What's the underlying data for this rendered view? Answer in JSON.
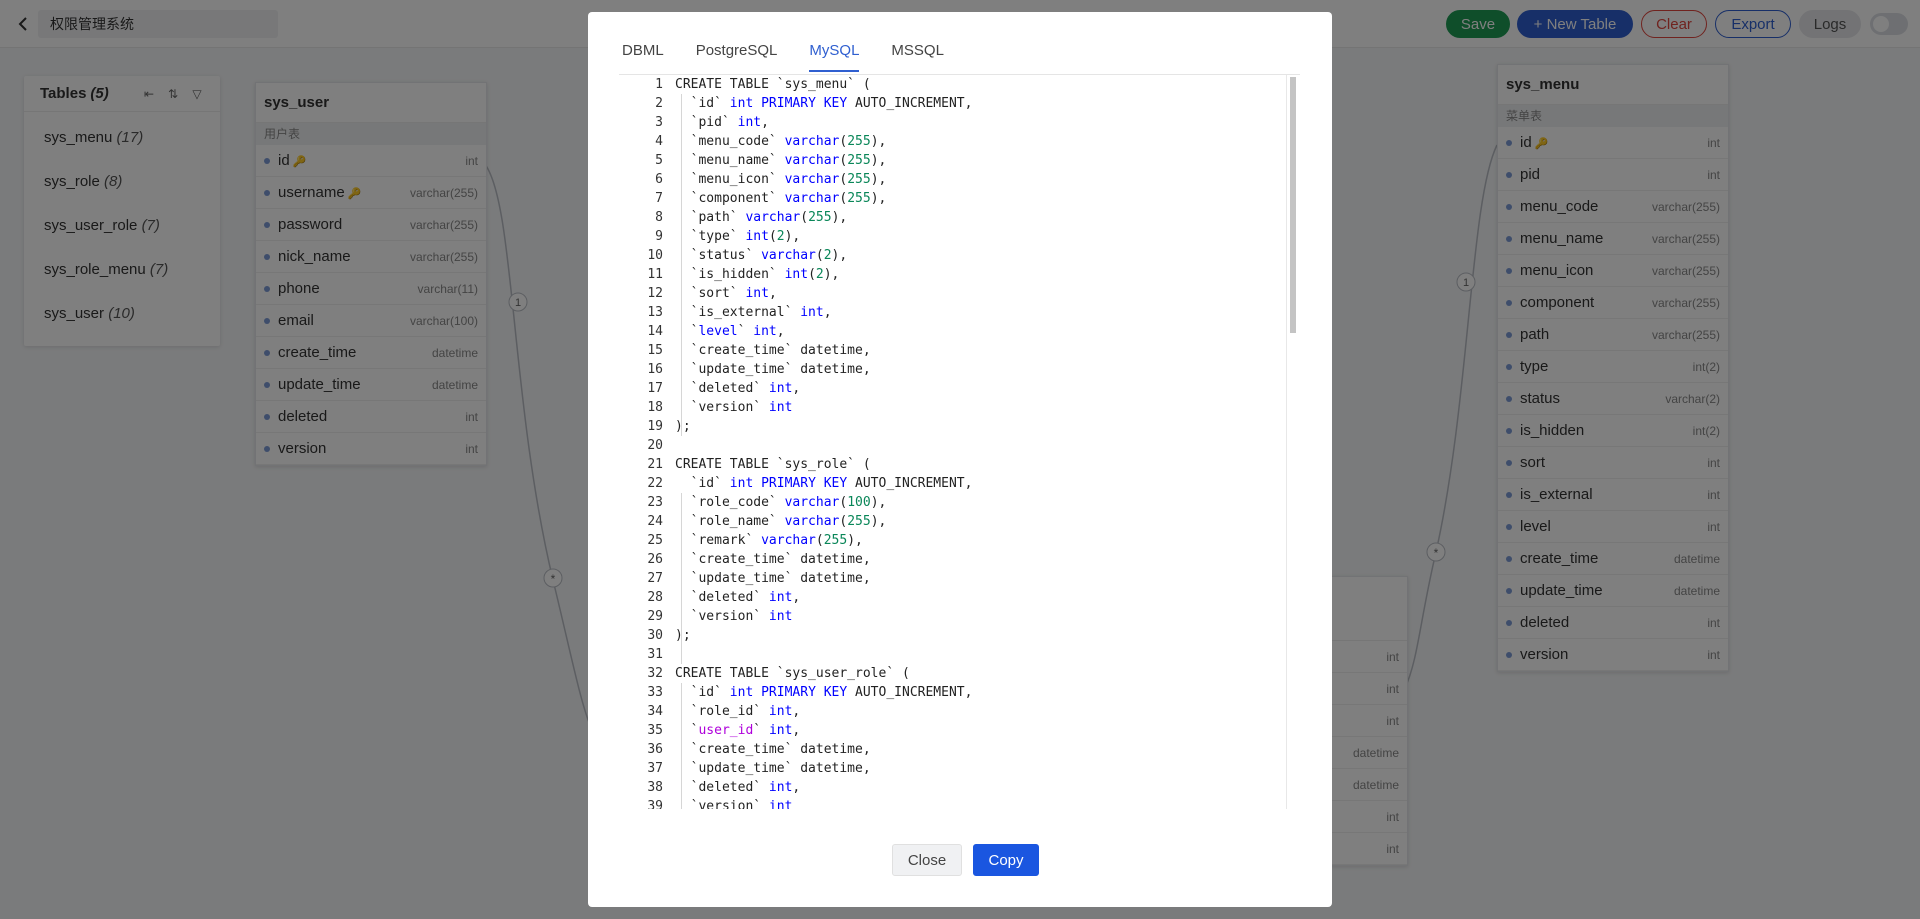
{
  "header": {
    "project_name": "权限管理系统",
    "save_label": "Save",
    "new_table_label": "+ New Table",
    "clear_label": "Clear",
    "export_label": "Export",
    "logs_label": "Logs"
  },
  "colors": {
    "save": "#1f9d55",
    "primary": "#2f5fd0",
    "danger": "#e0463e",
    "copy": "#1a56e0"
  },
  "sidebar": {
    "title": "Tables",
    "count": "(5)",
    "icons": [
      "collapse-left-icon",
      "sort-icon",
      "filter-icon"
    ],
    "items": [
      {
        "name": "sys_menu",
        "count": "(17)"
      },
      {
        "name": "sys_role",
        "count": "(8)"
      },
      {
        "name": "sys_user_role",
        "count": "(7)"
      },
      {
        "name": "sys_role_menu",
        "count": "(7)"
      },
      {
        "name": "sys_user",
        "count": "(10)"
      }
    ]
  },
  "sys_user": {
    "title": "sys_user",
    "note": "用户表",
    "fields": [
      {
        "name": "id",
        "type": "int",
        "key": "primary"
      },
      {
        "name": "username",
        "type": "varchar(255)",
        "key": "secondary"
      },
      {
        "name": "password",
        "type": "varchar(255)"
      },
      {
        "name": "nick_name",
        "type": "varchar(255)"
      },
      {
        "name": "phone",
        "type": "varchar(11)"
      },
      {
        "name": "email",
        "type": "varchar(100)"
      },
      {
        "name": "create_time",
        "type": "datetime"
      },
      {
        "name": "update_time",
        "type": "datetime"
      },
      {
        "name": "deleted",
        "type": "int"
      },
      {
        "name": "version",
        "type": "int"
      }
    ]
  },
  "sys_menu": {
    "title": "sys_menu",
    "note": "菜单表",
    "fields": [
      {
        "name": "id",
        "type": "int",
        "key": "primary"
      },
      {
        "name": "pid",
        "type": "int"
      },
      {
        "name": "menu_code",
        "type": "varchar(255)"
      },
      {
        "name": "menu_name",
        "type": "varchar(255)"
      },
      {
        "name": "menu_icon",
        "type": "varchar(255)"
      },
      {
        "name": "component",
        "type": "varchar(255)"
      },
      {
        "name": "path",
        "type": "varchar(255)"
      },
      {
        "name": "type",
        "type": "int(2)"
      },
      {
        "name": "status",
        "type": "varchar(2)"
      },
      {
        "name": "is_hidden",
        "type": "int(2)"
      },
      {
        "name": "sort",
        "type": "int"
      },
      {
        "name": "is_external",
        "type": "int"
      },
      {
        "name": "level",
        "type": "int"
      },
      {
        "name": "create_time",
        "type": "datetime"
      },
      {
        "name": "update_time",
        "type": "datetime"
      },
      {
        "name": "deleted",
        "type": "int"
      },
      {
        "name": "version",
        "type": "int"
      }
    ]
  },
  "middle_table": {
    "types": [
      "int",
      "int",
      "int",
      "datetime",
      "datetime",
      "int",
      "int"
    ]
  },
  "relations": {
    "one_left": "1",
    "many_left": "*",
    "one_right": "1",
    "many_right": "*"
  },
  "modal": {
    "tabs": [
      "DBML",
      "PostgreSQL",
      "MySQL",
      "MSSQL"
    ],
    "active_tab": "MySQL",
    "close_label": "Close",
    "copy_label": "Copy",
    "code_lines": [
      [
        [
          "CREATE TABLE `sys_menu` (",
          ""
        ]
      ],
      [
        [
          "  `id` ",
          ""
        ],
        [
          "int PRIMARY KEY",
          "kw"
        ],
        [
          " AUTO_INCREMENT,",
          ""
        ]
      ],
      [
        [
          "  `pid` ",
          ""
        ],
        [
          "int",
          "kw"
        ],
        [
          ",",
          ""
        ]
      ],
      [
        [
          "  `menu_code` ",
          ""
        ],
        [
          "varchar",
          "kw"
        ],
        [
          "(",
          ""
        ],
        [
          "255",
          "num"
        ],
        [
          "),",
          ""
        ]
      ],
      [
        [
          "  `menu_name` ",
          ""
        ],
        [
          "varchar",
          "kw"
        ],
        [
          "(",
          ""
        ],
        [
          "255",
          "num"
        ],
        [
          "),",
          ""
        ]
      ],
      [
        [
          "  `menu_icon` ",
          ""
        ],
        [
          "varchar",
          "kw"
        ],
        [
          "(",
          ""
        ],
        [
          "255",
          "num"
        ],
        [
          "),",
          ""
        ]
      ],
      [
        [
          "  `component` ",
          ""
        ],
        [
          "varchar",
          "kw"
        ],
        [
          "(",
          ""
        ],
        [
          "255",
          "num"
        ],
        [
          "),",
          ""
        ]
      ],
      [
        [
          "  `path` ",
          ""
        ],
        [
          "varchar",
          "kw"
        ],
        [
          "(",
          ""
        ],
        [
          "255",
          "num"
        ],
        [
          "),",
          ""
        ]
      ],
      [
        [
          "  `type` ",
          ""
        ],
        [
          "int",
          "kw"
        ],
        [
          "(",
          ""
        ],
        [
          "2",
          "num"
        ],
        [
          "),",
          ""
        ]
      ],
      [
        [
          "  `status` ",
          ""
        ],
        [
          "varchar",
          "kw"
        ],
        [
          "(",
          ""
        ],
        [
          "2",
          "num"
        ],
        [
          "),",
          ""
        ]
      ],
      [
        [
          "  `is_hidden` ",
          ""
        ],
        [
          "int",
          "kw"
        ],
        [
          "(",
          ""
        ],
        [
          "2",
          "num"
        ],
        [
          "),",
          ""
        ]
      ],
      [
        [
          "  `sort` ",
          ""
        ],
        [
          "int",
          "kw"
        ],
        [
          ",",
          ""
        ]
      ],
      [
        [
          "  `is_external` ",
          ""
        ],
        [
          "int",
          "kw"
        ],
        [
          ",",
          ""
        ]
      ],
      [
        [
          "  `",
          ""
        ],
        [
          "level",
          "kw"
        ],
        [
          "` ",
          ""
        ],
        [
          "int",
          "kw"
        ],
        [
          ",",
          ""
        ]
      ],
      [
        [
          "  `create_time` datetime,",
          ""
        ]
      ],
      [
        [
          "  `update_time` datetime,",
          ""
        ]
      ],
      [
        [
          "  `deleted` ",
          ""
        ],
        [
          "int",
          "kw"
        ],
        [
          ",",
          ""
        ]
      ],
      [
        [
          "  `version` ",
          ""
        ],
        [
          "int",
          "kw"
        ]
      ],
      [
        [
          ");",
          ""
        ]
      ],
      [
        [
          "",
          ""
        ]
      ],
      [
        [
          "CREATE TABLE `sys_role` (",
          ""
        ]
      ],
      [
        [
          "  `id` ",
          ""
        ],
        [
          "int PRIMARY KEY",
          "kw"
        ],
        [
          " AUTO_INCREMENT,",
          ""
        ]
      ],
      [
        [
          "  `role_code` ",
          ""
        ],
        [
          "varchar",
          "kw"
        ],
        [
          "(",
          ""
        ],
        [
          "100",
          "num"
        ],
        [
          "),",
          ""
        ]
      ],
      [
        [
          "  `role_name` ",
          ""
        ],
        [
          "varchar",
          "kw"
        ],
        [
          "(",
          ""
        ],
        [
          "255",
          "num"
        ],
        [
          "),",
          ""
        ]
      ],
      [
        [
          "  `remark` ",
          ""
        ],
        [
          "varchar",
          "kw"
        ],
        [
          "(",
          ""
        ],
        [
          "255",
          "num"
        ],
        [
          "),",
          ""
        ]
      ],
      [
        [
          "  `create_time` datetime,",
          ""
        ]
      ],
      [
        [
          "  `update_time` datetime,",
          ""
        ]
      ],
      [
        [
          "  `deleted` ",
          ""
        ],
        [
          "int",
          "kw"
        ],
        [
          ",",
          ""
        ]
      ],
      [
        [
          "  `version` ",
          ""
        ],
        [
          "int",
          "kw"
        ]
      ],
      [
        [
          ");",
          ""
        ]
      ],
      [
        [
          "",
          ""
        ]
      ],
      [
        [
          "CREATE TABLE `sys_user_role` (",
          ""
        ]
      ],
      [
        [
          "  `id` ",
          ""
        ],
        [
          "int PRIMARY KEY",
          "kw"
        ],
        [
          " AUTO_INCREMENT,",
          ""
        ]
      ],
      [
        [
          "  `role_id` ",
          ""
        ],
        [
          "int",
          "kw"
        ],
        [
          ",",
          ""
        ]
      ],
      [
        [
          "  `",
          ""
        ],
        [
          "user_id",
          "pur"
        ],
        [
          "` ",
          ""
        ],
        [
          "int",
          "kw"
        ],
        [
          ",",
          ""
        ]
      ],
      [
        [
          "  `create_time` datetime,",
          ""
        ]
      ],
      [
        [
          "  `update_time` datetime,",
          ""
        ]
      ],
      [
        [
          "  `deleted` ",
          ""
        ],
        [
          "int",
          "kw"
        ],
        [
          ",",
          ""
        ]
      ],
      [
        [
          "  `version` ",
          ""
        ],
        [
          "int",
          "kw"
        ]
      ]
    ]
  }
}
